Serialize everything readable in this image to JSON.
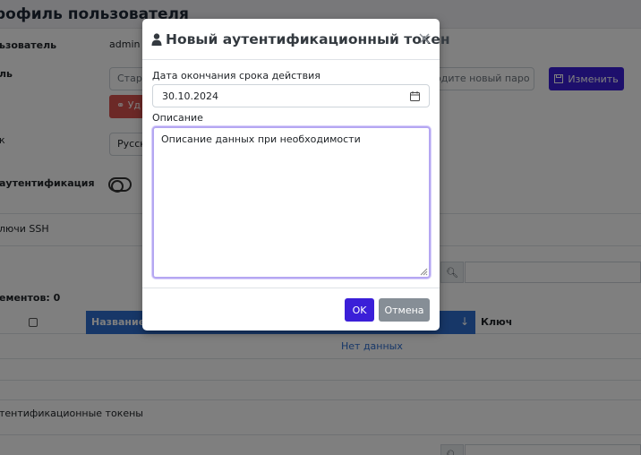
{
  "background": {
    "page_title": "рофиль пользователя",
    "user_label": "ьзователь",
    "user_value": "admin",
    "password_label": "ль",
    "old_password_placeholder": "Стары",
    "new_password_placeholder": "ердите новый паро",
    "change_button": "Изменить",
    "delete_button": "Уд",
    "language_label": "к",
    "language_value": "Русск",
    "auth_label": "аутентификация",
    "ssh_keys_label": "лючи SSH",
    "elements_count": "ементов: 0",
    "table": {
      "col_name": "Название",
      "col_key": "Ключ",
      "no_data": "Нет данных"
    },
    "tokens_label": "тентификационные токены"
  },
  "modal": {
    "title": "Новый аутентификационный токен",
    "expiry_label": "Дата окончания срока действия",
    "expiry_value": "30.10.2024",
    "description_label": "Описание",
    "description_placeholder": "Описание данных при необходимости",
    "ok_button": "OK",
    "cancel_button": "Отмена"
  },
  "icons": {
    "user": "user-icon",
    "close": "close-icon",
    "calendar": "calendar-icon",
    "save": "save-icon",
    "search": "search-icon",
    "sort": "sort-down-icon",
    "key_unlink": "unlink-icon"
  },
  "colors": {
    "primary": "#3b1fd8",
    "secondary": "#868e96",
    "danger": "#d9534f",
    "table_header": "#2f6fd1",
    "overlay": "rgba(0,0,0,0.5)"
  }
}
